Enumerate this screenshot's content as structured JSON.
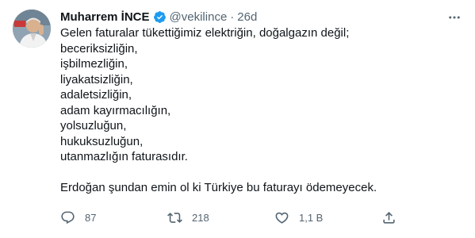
{
  "tweet": {
    "author_name": "Muharrem İNCE",
    "handle": "@vekilince",
    "separator": "·",
    "time": "26d",
    "lines": [
      "Gelen faturalar tükettiğimiz elektriğin, doğalgazın değil;",
      "beceriksizliğin,",
      "işbilmezliğin,",
      "liyakatsizliğin,",
      "adaletsizliğin,",
      "adam kayırmacılığın,",
      "yolsuzluğun,",
      "hukuksuzluğun,",
      "utanmazlığın faturasıdır."
    ],
    "closing_line": "Erdoğan şundan emin ol ki Türkiye bu faturayı ödemeyecek."
  },
  "actions": {
    "reply_count": "87",
    "retweet_count": "218",
    "like_count": "1,1 B"
  },
  "icons": {
    "verified": "verified-badge-icon",
    "more": "more-dots-icon",
    "reply": "reply-icon",
    "retweet": "retweet-icon",
    "like": "heart-icon",
    "share": "share-icon"
  },
  "colors": {
    "text": "#0f1419",
    "secondary": "#536471",
    "verified": "#1d9bf0"
  }
}
